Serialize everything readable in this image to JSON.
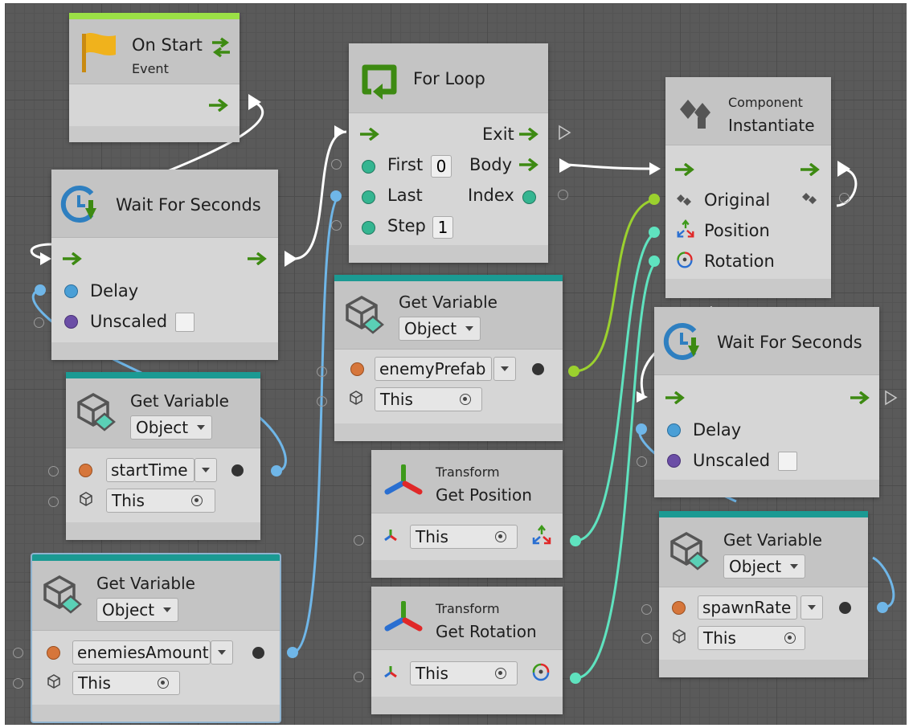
{
  "nodes": {
    "on_start": {
      "title": "On Start",
      "subtitle": "Event"
    },
    "wait1": {
      "title": "Wait For Seconds",
      "delay": "Delay",
      "unscaled": "Unscaled"
    },
    "get_var_start": {
      "title": "Get Variable",
      "kind": "Object",
      "name": "startTime",
      "target": "This"
    },
    "get_var_amount": {
      "title": "Get Variable",
      "kind": "Object",
      "name": "enemiesAmount",
      "target": "This"
    },
    "for_loop": {
      "title": "For Loop",
      "exit": "Exit",
      "first": "First",
      "first_value": "0",
      "body": "Body",
      "last": "Last",
      "index": "Index",
      "step": "Step",
      "step_value": "1"
    },
    "get_var_prefab": {
      "title": "Get Variable",
      "kind": "Object",
      "name": "enemyPrefab",
      "target": "This"
    },
    "get_position": {
      "category": "Transform",
      "title": "Get Position",
      "target": "This"
    },
    "get_rotation": {
      "category": "Transform",
      "title": "Get Rotation",
      "target": "This"
    },
    "instantiate": {
      "category": "Component",
      "title": "Instantiate",
      "original": "Original",
      "position": "Position",
      "rotation": "Rotation"
    },
    "wait2": {
      "title": "Wait For Seconds",
      "delay": "Delay",
      "unscaled": "Unscaled"
    },
    "get_var_spawn": {
      "title": "Get Variable",
      "kind": "Object",
      "name": "spawnRate",
      "target": "This"
    }
  },
  "colors": {
    "flow_arrow": "#3d8a12",
    "event_bar": "#9be046",
    "variable_bar": "#1b9a93",
    "wire_white": "#ffffff",
    "wire_blue": "#6fb6e8",
    "wire_lime": "#9bd12e",
    "wire_teal": "#5fe3bf"
  }
}
